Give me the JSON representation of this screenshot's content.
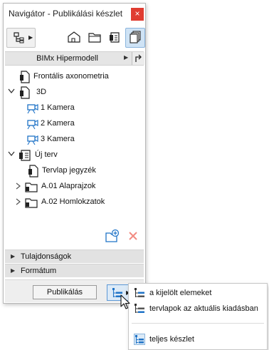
{
  "window": {
    "title": "Navigátor - Publikálási készlet",
    "close_glyph": "×"
  },
  "toolbar": {
    "buttons": [
      {
        "icon": "project-map-dropdown-icon"
      },
      {
        "icon": "house-icon"
      },
      {
        "icon": "folder-icon"
      },
      {
        "icon": "layout-book-icon"
      },
      {
        "icon": "publisher-sets-icon",
        "active": true
      }
    ]
  },
  "model_bar": {
    "label": "BIMx Hipermodell",
    "arrow": "▶"
  },
  "tree": {
    "items": [
      {
        "label": "Frontális axonometria",
        "icon": "view-document-icon"
      },
      {
        "label": "3D",
        "icon": "view-document-icon",
        "expanded": true
      },
      {
        "label": "1 Kamera",
        "icon": "camera-icon"
      },
      {
        "label": "2 Kamera",
        "icon": "camera-icon"
      },
      {
        "label": "3 Kamera",
        "icon": "camera-icon"
      },
      {
        "label": "Új terv",
        "icon": "layout-book-icon",
        "expanded": true
      },
      {
        "label": "Tervlap jegyzék",
        "icon": "view-document-icon"
      },
      {
        "label": "A.01 Alaprajzok",
        "icon": "subset-folder-icon",
        "expanded": false
      },
      {
        "label": "A.02 Homlokzatok",
        "icon": "subset-folder-icon",
        "expanded": false
      }
    ]
  },
  "sections": {
    "properties": "Tulajdonságok",
    "format": "Formátum"
  },
  "footer": {
    "publish_label": "Publikálás"
  },
  "menu": {
    "items": [
      {
        "label": "a kijelölt elemeket"
      },
      {
        "label": "tervlapok az aktuális kiadásban"
      },
      {
        "label": "teljes készlet"
      }
    ]
  },
  "colors": {
    "accent": "#1f73c7",
    "close": "#e03c31",
    "delete": "#f28b82"
  }
}
